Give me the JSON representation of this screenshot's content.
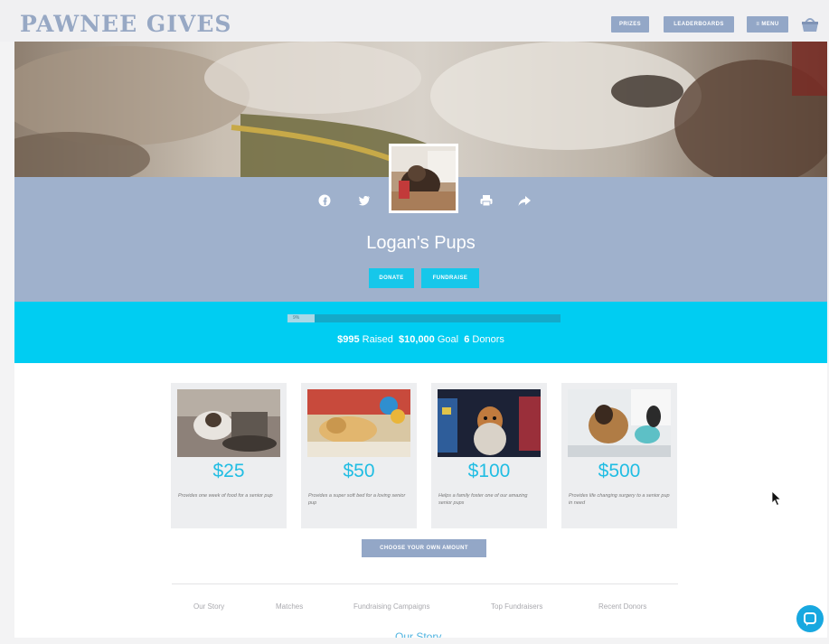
{
  "brand": "PAWNEE GIVES",
  "nav": {
    "prizes": "PRIZES",
    "leaderboard": "LEADERBOARDS",
    "menu": "≡ MENU"
  },
  "org": {
    "name": "Logan's Pups"
  },
  "hero_buttons": {
    "donate": "DONATE",
    "fundraise": "FUNDRAISE"
  },
  "progress": {
    "percent_label": "9%",
    "fill_percent": 9.95,
    "raised_amount": "$995",
    "raised_label": "Raised",
    "goal_amount": "$10,000",
    "goal_label": "Goal",
    "donors_count": "6",
    "donors_label": "Donors"
  },
  "cards": [
    {
      "amount": "$25",
      "description": "Provides one week of food for a senior pup"
    },
    {
      "amount": "$50",
      "description": "Provides a super soft bed for a loving senior pup"
    },
    {
      "amount": "$100",
      "description": "Helps a family foster one of our amazing senior pups"
    },
    {
      "amount": "$500",
      "description": "Provides life changing surgery to a senior pup in need"
    }
  ],
  "own_amount": "CHOOSE YOUR OWN AMOUNT",
  "tabs": [
    "Our Story",
    "Matches",
    "Fundraising Campaigns",
    "Top Fundraisers",
    "Recent Donors"
  ],
  "section_heading": "Our Story",
  "colors": {
    "accent": "#00cdf2",
    "band": "#9fb1cc",
    "nav": "#93a7c7",
    "amount": "#21bde3"
  }
}
